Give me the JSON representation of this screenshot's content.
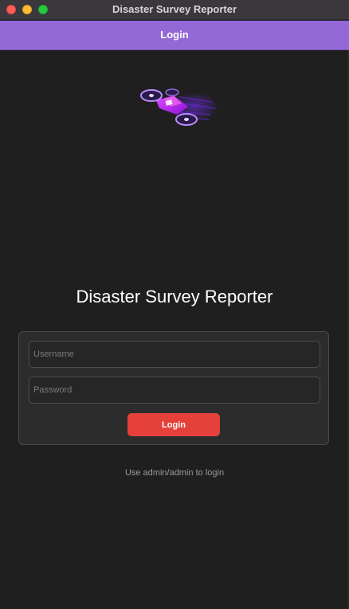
{
  "window": {
    "title": "Disaster Survey Reporter"
  },
  "appbar": {
    "title": "Login"
  },
  "logo": {
    "icon": "drone-icon",
    "accent": "#b01cff"
  },
  "main": {
    "heading": "Disaster Survey Reporter"
  },
  "form": {
    "username_placeholder": "Username",
    "password_placeholder": "Password",
    "username_value": "",
    "password_value": "",
    "login_label": "Login"
  },
  "hint": "Use admin/admin to login",
  "colors": {
    "appbar": "#9468d6",
    "button": "#e5403a",
    "background": "#1f1f1f"
  }
}
